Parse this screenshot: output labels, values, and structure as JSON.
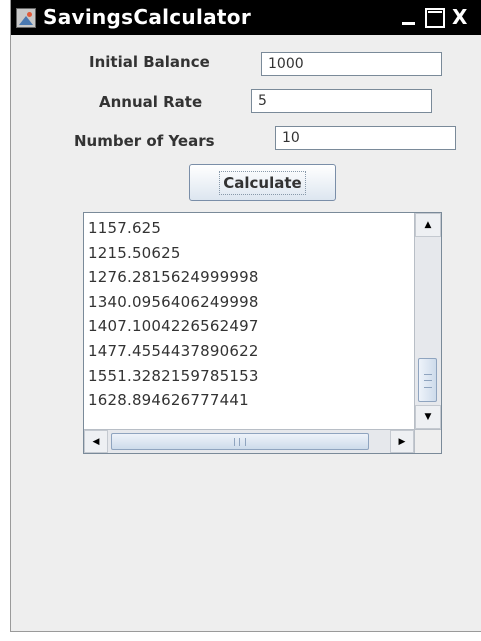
{
  "window": {
    "title": "SavingsCalculator",
    "close_glyph": "X",
    "icons": [
      "app-icon",
      "minimize-icon",
      "maximize-icon",
      "close-icon"
    ]
  },
  "form": {
    "initial_balance": {
      "label": "Initial Balance",
      "value": "1000"
    },
    "annual_rate": {
      "label": "Annual Rate",
      "value": "5"
    },
    "number_of_years": {
      "label": "Number of Years",
      "value": "10"
    },
    "calculate_label": "Calculate"
  },
  "results": [
    "1157.625",
    "1215.50625",
    "1276.2815624999998",
    "1340.0956406249998",
    "1407.1004226562497",
    "1477.4554437890622",
    "1551.3282159785153",
    "1628.894626777441"
  ],
  "scrollbars": {
    "up_arrow": "▲",
    "down_arrow": "▼",
    "left_arrow": "◀",
    "right_arrow": "▶"
  },
  "colors": {
    "titlebar": "#000000",
    "window_background": "#eeeeee",
    "scroll_thumb": "#cddbeb"
  }
}
